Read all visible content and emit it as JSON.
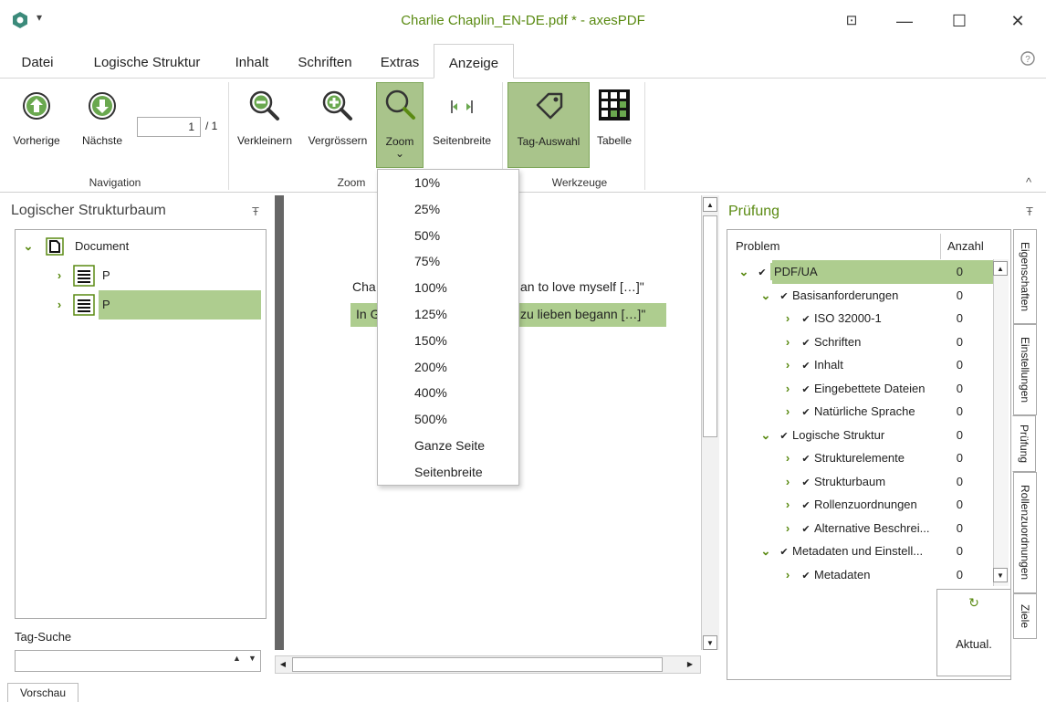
{
  "window": {
    "title": "Charlie Chaplin_EN-DE.pdf * - axesPDF",
    "app_menu_arrow": "▾",
    "buttons": {
      "restore": "⊡",
      "minimize": "—",
      "maximize": "☐",
      "close": "✕"
    }
  },
  "menu": {
    "items": [
      "Datei",
      "Logische Struktur",
      "Inhalt",
      "Schriften",
      "Extras",
      "Anzeige"
    ],
    "active": "Anzeige",
    "help_icon": "?"
  },
  "ribbon": {
    "navigation": {
      "prev_label": "Vorherige",
      "next_label": "Nächste",
      "page_value": "1",
      "page_total": "/ 1",
      "group_label": "Navigation"
    },
    "zoom": {
      "zoom_out_label": "Verkleinern",
      "zoom_in_label": "Vergrössern",
      "zoom_label": "Zoom",
      "zoom_arrow": "⌄",
      "page_width_label": "Seitenbreite",
      "group_label": "Zoom"
    },
    "tools": {
      "tag_select_label": "Tag-Auswahl",
      "table_label": "Tabelle",
      "group_label": "Werkzeuge"
    },
    "collapse_icon": "^"
  },
  "zoom_dropdown": {
    "options": [
      "10%",
      "25%",
      "50%",
      "75%",
      "100%",
      "125%",
      "150%",
      "200%",
      "400%",
      "500%",
      "Ganze Seite",
      "Seitenbreite"
    ]
  },
  "left_panel": {
    "title": "Logischer Strukturbaum",
    "pin": "Ŧ",
    "tree": [
      {
        "label": "Document",
        "level": 0,
        "expanded": true,
        "selected": false
      },
      {
        "label": "P",
        "level": 1,
        "expanded": false,
        "selected": false
      },
      {
        "label": "P",
        "level": 1,
        "expanded": false,
        "selected": true
      }
    ],
    "tag_search_label": "Tag-Suche",
    "tag_search_value": ""
  },
  "document": {
    "line1": "Cha",
    "line1_rest": "an to love myself […]\"",
    "line2": "In G",
    "line2_rest": "zu lieben begann […]\""
  },
  "right_panel": {
    "title": "Prüfung",
    "pin": "Ŧ",
    "columns": {
      "problem": "Problem",
      "count": "Anzahl"
    },
    "rows": [
      {
        "label": "PDF/UA",
        "level": 0,
        "chev": "⌄",
        "count": "0",
        "selected": true
      },
      {
        "label": "Basisanforderungen",
        "level": 1,
        "chev": "⌄",
        "count": "0",
        "selected": false
      },
      {
        "label": "ISO 32000-1",
        "level": 2,
        "chev": ">",
        "count": "0",
        "selected": false
      },
      {
        "label": "Schriften",
        "level": 2,
        "chev": ">",
        "count": "0",
        "selected": false
      },
      {
        "label": "Inhalt",
        "level": 2,
        "chev": ">",
        "count": "0",
        "selected": false
      },
      {
        "label": "Eingebettete Dateien",
        "level": 2,
        "chev": ">",
        "count": "0",
        "selected": false
      },
      {
        "label": "Natürliche Sprache",
        "level": 2,
        "chev": ">",
        "count": "0",
        "selected": false
      },
      {
        "label": "Logische Struktur",
        "level": 1,
        "chev": "⌄",
        "count": "0",
        "selected": false
      },
      {
        "label": "Strukturelemente",
        "level": 2,
        "chev": ">",
        "count": "0",
        "selected": false
      },
      {
        "label": "Strukturbaum",
        "level": 2,
        "chev": ">",
        "count": "0",
        "selected": false
      },
      {
        "label": "Rollenzuordnungen",
        "level": 2,
        "chev": ">",
        "count": "0",
        "selected": false
      },
      {
        "label": "Alternative Beschrei...",
        "level": 2,
        "chev": ">",
        "count": "0",
        "selected": false
      },
      {
        "label": "Metadaten und Einstell...",
        "level": 1,
        "chev": "⌄",
        "count": "0",
        "selected": false
      },
      {
        "label": "Metadaten",
        "level": 2,
        "chev": ">",
        "count": "0",
        "selected": false
      }
    ],
    "refresh_label": "Aktual."
  },
  "side_tabs": [
    "Eigenschaften",
    "Einstellungen",
    "Prüfung",
    "Rollenzuordnungen",
    "Ziele"
  ],
  "bottom_tab": "Vorschau",
  "colors": {
    "accent": "#5a8a12",
    "selection": "#aecd8f"
  }
}
